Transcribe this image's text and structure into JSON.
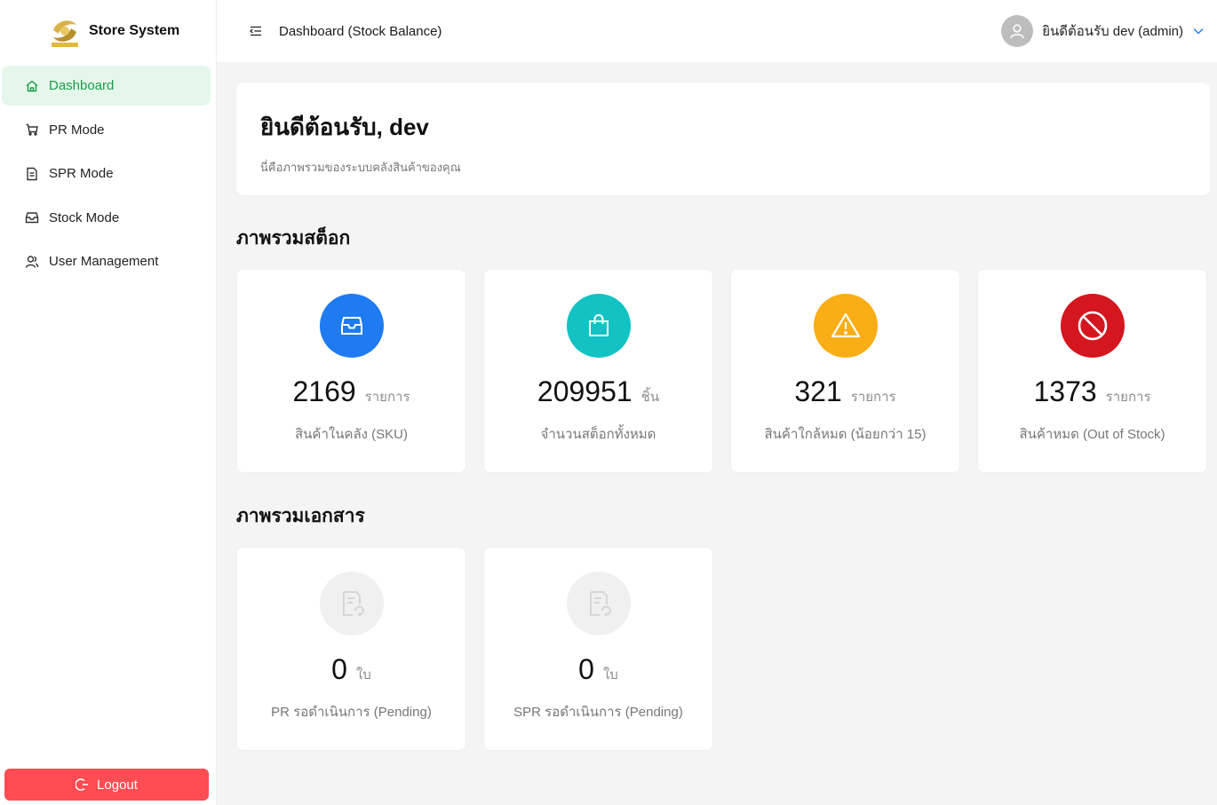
{
  "brand": {
    "name": "Store System"
  },
  "nav": [
    {
      "label": "Dashboard",
      "icon": "home-icon",
      "active": true
    },
    {
      "label": "PR Mode",
      "icon": "cart-icon"
    },
    {
      "label": "SPR Mode",
      "icon": "document-icon"
    },
    {
      "label": "Stock Mode",
      "icon": "inbox-icon"
    },
    {
      "label": "User Management",
      "icon": "users-icon"
    }
  ],
  "logout": {
    "label": "Logout",
    "icon": "logout-icon"
  },
  "header": {
    "title": "Dashboard (Stock Balance)",
    "user_label": "ยินดีต้อนรับ dev (admin)"
  },
  "welcome": {
    "title": "ยินดีต้อนรับ, dev",
    "subtitle": "นี่คือภาพรวมของระบบคลังสินค้าของคุณ"
  },
  "stock_section": {
    "title": "ภาพรวมสต็อก",
    "cards": [
      {
        "value": "2169",
        "unit": "รายการ",
        "label": "สินค้าในคลัง (SKU)",
        "color": "#1e7bf2",
        "icon": "inbox-icon"
      },
      {
        "value": "209951",
        "unit": "ชิ้น",
        "label": "จำนวนสต็อกทั้งหมด",
        "color": "#13c2c2",
        "icon": "shopping-bag-icon"
      },
      {
        "value": "321",
        "unit": "รายการ",
        "label": "สินค้าใกล้หมด (น้อยกว่า 15)",
        "color": "#faad14",
        "icon": "warning-icon"
      },
      {
        "value": "1373",
        "unit": "รายการ",
        "label": "สินค้าหมด (Out of Stock)",
        "color": "#d4161f",
        "icon": "stop-icon"
      }
    ]
  },
  "docs_section": {
    "title": "ภาพรวมเอกสาร",
    "cards": [
      {
        "value": "0",
        "unit": "ใบ",
        "label": "PR รอดำเนินการ (Pending)",
        "color": "#f0f0f0",
        "icon": "document-sync-icon"
      },
      {
        "value": "0",
        "unit": "ใบ",
        "label": "SPR รอดำเนินการ (Pending)",
        "color": "#f0f0f0",
        "icon": "document-sync-icon"
      }
    ]
  },
  "colors": {
    "accent": "#1b9b4b",
    "active_bg": "#e4f7ea",
    "logout": "#ff4d53"
  }
}
